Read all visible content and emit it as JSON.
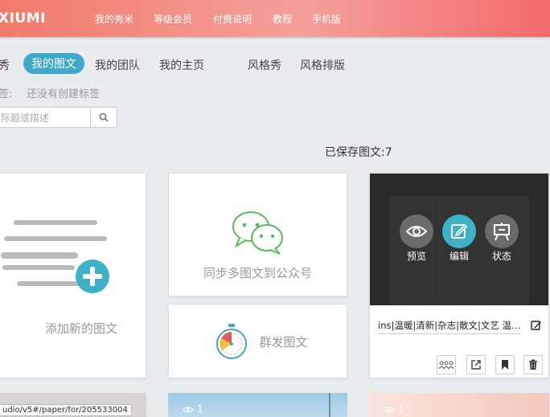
{
  "topbar": {
    "logo": "XIUMI",
    "nav": [
      "我的秀米",
      "等级会员",
      "付费说明",
      "教程",
      "手机版"
    ]
  },
  "subnav": {
    "items": [
      "秀",
      "我的图文",
      "我的团队",
      "我的主页",
      "风格秀",
      "风格排版"
    ],
    "active_index": 1
  },
  "tags": {
    "label": "签:",
    "empty_text": "还没有创建标签"
  },
  "search": {
    "placeholder": "际题或描述"
  },
  "saved_text": "已保存图文:7",
  "cards": {
    "add_new_label": "添加新的图文",
    "sync_label": "同步多图文到公众号",
    "mass_send_label": "群发图文",
    "article": {
      "overlay_preview": "预览",
      "overlay_edit": "编辑",
      "overlay_status": "状态",
      "title": "ins|温暖|清新|杂志|散文|文艺 温柔 暖色 信息"
    }
  },
  "bottom_row": {
    "card2_count": "1",
    "card3_count": "1"
  },
  "url_tooltip": "udio/v5#/paper/for/205533004",
  "colors": {
    "accent": "#3fa9c9",
    "topbar_start": "#f27a6c",
    "topbar_end": "#f46b6b",
    "wechat_green": "#5cb85c"
  }
}
